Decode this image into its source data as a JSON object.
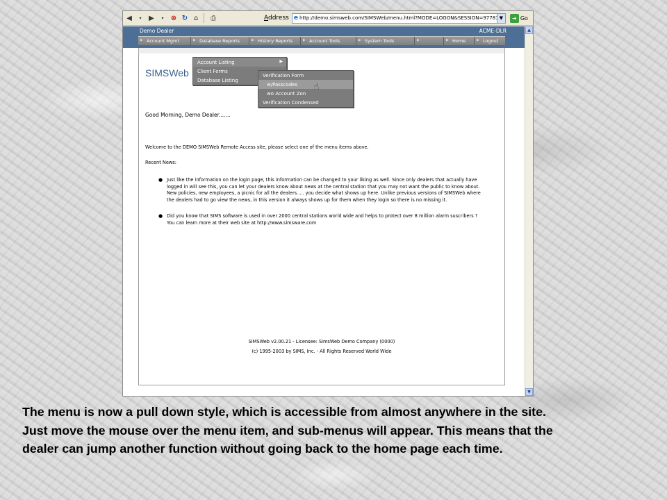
{
  "browser": {
    "address_label_prefix": "A",
    "address_label_rest": "ddress",
    "url": "http://demo.simsweb.com/SIMSWeb/menu.html?MODE=LOGON&SESSION=97781",
    "go_label": "Go"
  },
  "header": {
    "dealer_name": "Demo Dealer",
    "dealer_code": "ACME-DLR"
  },
  "menubar": {
    "items": [
      {
        "label": "Account Mgmt"
      },
      {
        "label": "Database Reports"
      },
      {
        "label": "History Reports"
      },
      {
        "label": "Account Tools"
      },
      {
        "label": "System Tools"
      },
      {
        "label": ""
      },
      {
        "label": "Home"
      },
      {
        "label": "Logout"
      }
    ]
  },
  "dropdown_level1": {
    "items": [
      {
        "label": "Account Listing",
        "has_submenu": true
      },
      {
        "label": "Client Forms",
        "has_submenu": false
      },
      {
        "label": "Database Listing",
        "has_submenu": false
      }
    ]
  },
  "dropdown_level2": {
    "items": [
      {
        "label": "Verification Form"
      },
      {
        "label": "w/Passcodes"
      },
      {
        "label": "wo Account Zon"
      },
      {
        "label": "Verification Condensed"
      }
    ]
  },
  "page": {
    "logo": "SIMSWeb",
    "greeting": "Good Morning, Demo Dealer.......",
    "welcome": "Welcome to the DEMO SIMSWeb Remote Access site, please select one of the menu items above.",
    "news_label": "Recent News:",
    "news": [
      "Just like the information on the login page, this information can be changed to your liking as well. Since only dealers that actually have logged in will see this, you can let your dealers know about news at the central station that you may not want the public to know about. New policies, new employees, a picnic for all the dealers..... you decide what shows up here. Unlike previous versions of SIMSWeb where the dealers had to go view the news, in this version it always shows up for them when they login so there is no missing it.",
      "Did you know that SIMS software is used in over 2000 central stations world wide and helps to protect over 8 million alarm suscribers ? You can learn more at their web site at http://www.simsware.com"
    ],
    "footer_line1": "SIMSWeb v2.00.21 - Licensee: SimsWeb Demo Company (0000)",
    "footer_line2": "(c) 1995-2003 by SIMS, Inc. - All Rights Reserved World Wide"
  },
  "caption": {
    "line1": "The menu is now a pull down style, which is accessible from almost anywhere in the site.",
    "line2": "Just move the mouse over the menu item, and sub-menus will appear.  This means that the",
    "line3": "dealer can jump another function without going back to the home page each time."
  },
  "icons": {
    "back": "back-arrow-icon",
    "forward": "forward-arrow-icon",
    "stop": "stop-icon",
    "refresh": "refresh-icon",
    "home": "home-icon",
    "print": "print-icon",
    "go": "go-arrow-icon"
  },
  "colors": {
    "header_blue": "#4d6f96",
    "menu_gray": "#7c7c7c"
  }
}
